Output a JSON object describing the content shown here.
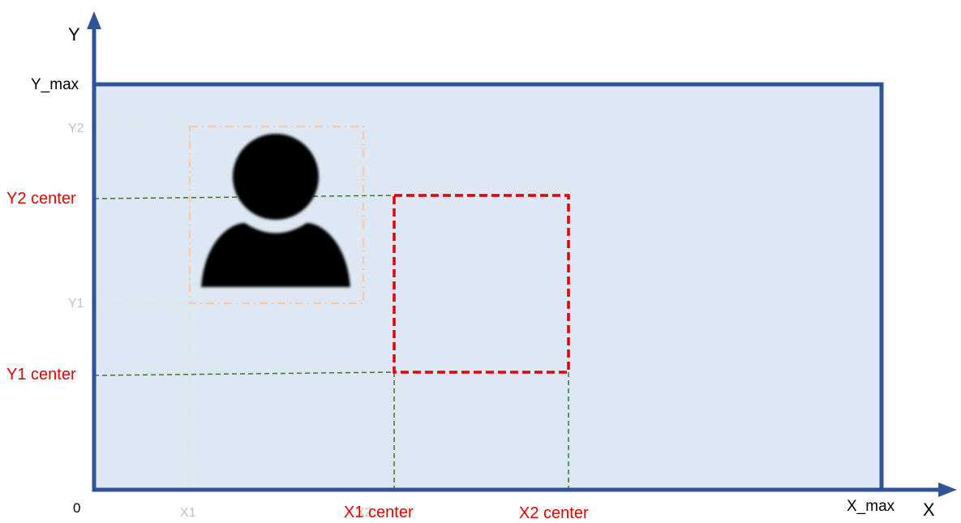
{
  "axes": {
    "x_label": "X",
    "y_label": "Y",
    "origin_label": "0",
    "x_max_label": "X_max",
    "y_max_label": "Y_max"
  },
  "person_box": {
    "x1_label": "X1",
    "x2_label": "X2",
    "y1_label": "Y1",
    "y2_label": "Y2"
  },
  "center_box": {
    "x1_label": "X1 center",
    "x2_label": "X2 center",
    "y1_label": "Y1 center",
    "y2_label": "Y2 center"
  },
  "icons": {
    "person": "person-icon"
  },
  "colors": {
    "axis": "#2f5597",
    "frame_fill": "#dee8f5",
    "person_box": "#f8cbad",
    "center_box": "#e00000",
    "guide_green": "#3c7a28",
    "guide_grey": "#e4e4e4"
  }
}
